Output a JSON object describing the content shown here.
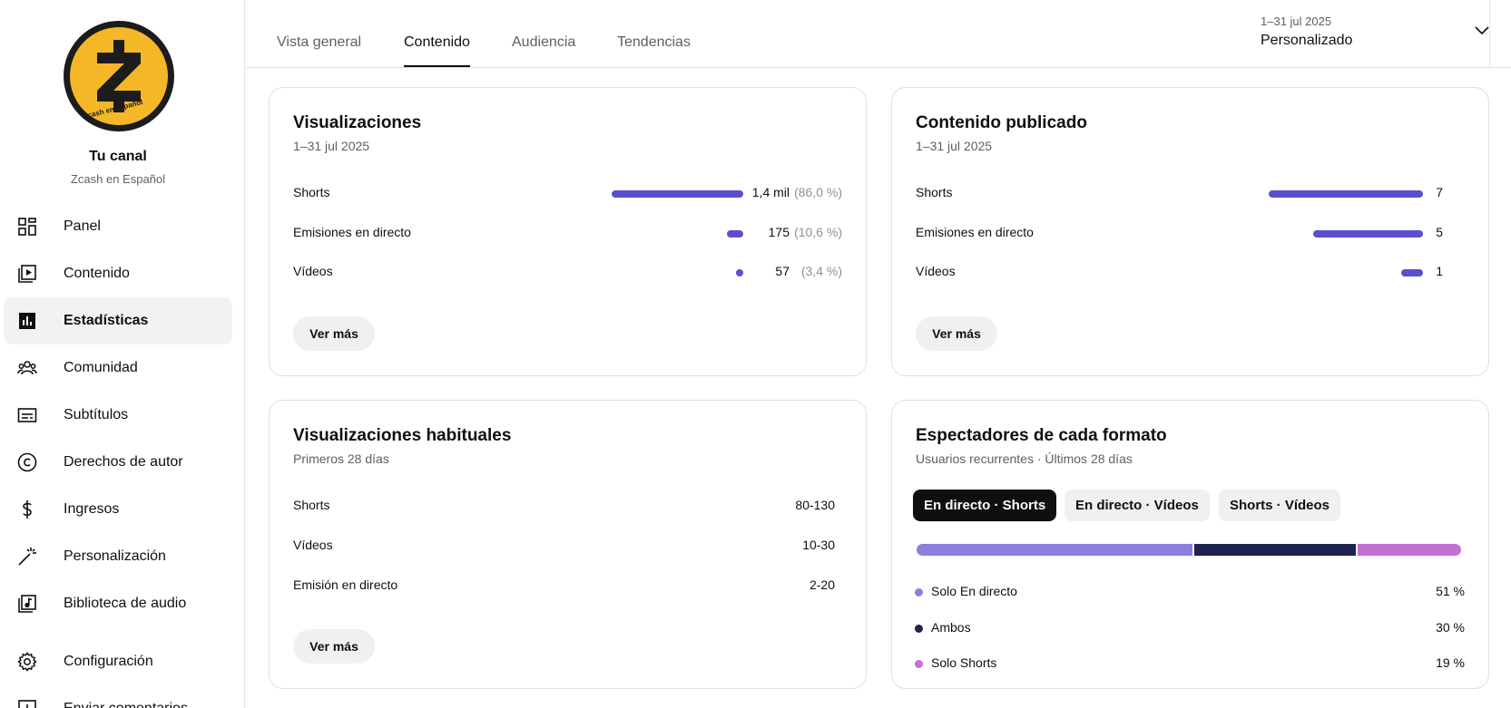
{
  "sidebar": {
    "channel_title": "Tu canal",
    "channel_name": "Zcash en Español",
    "avatar_text": "Zcash en español",
    "items": [
      {
        "label": "Panel",
        "icon": "dashboard-icon"
      },
      {
        "label": "Contenido",
        "icon": "content-icon"
      },
      {
        "label": "Estadísticas",
        "icon": "analytics-icon",
        "active": true
      },
      {
        "label": "Comunidad",
        "icon": "community-icon"
      },
      {
        "label": "Subtítulos",
        "icon": "subtitles-icon"
      },
      {
        "label": "Derechos de autor",
        "icon": "copyright-icon"
      },
      {
        "label": "Ingresos",
        "icon": "dollar-icon"
      },
      {
        "label": "Personalización",
        "icon": "magic-wand-icon"
      },
      {
        "label": "Biblioteca de audio",
        "icon": "audio-library-icon"
      },
      {
        "label": "Configuración",
        "icon": "gear-icon"
      },
      {
        "label": "Enviar comentarios",
        "icon": "feedback-icon"
      }
    ]
  },
  "tabs": [
    {
      "label": "Vista general"
    },
    {
      "label": "Contenido",
      "active": true
    },
    {
      "label": "Audiencia"
    },
    {
      "label": "Tendencias"
    }
  ],
  "date_range": {
    "range": "1–31 jul 2025",
    "label": "Personalizado"
  },
  "views_card": {
    "title": "Visualizaciones",
    "subtitle": "1–31 jul 2025",
    "rows": [
      {
        "label": "Shorts",
        "value": "1,4 mil",
        "pct": "(86,0 %)",
        "fraction": 0.86
      },
      {
        "label": "Emisiones en directo",
        "value": "175",
        "pct": "(10,6 %)",
        "fraction": 0.106
      },
      {
        "label": "Vídeos",
        "value": "57",
        "pct": "(3,4 %)",
        "fraction": 0.034
      }
    ],
    "button": "Ver más"
  },
  "published_card": {
    "title": "Contenido publicado",
    "subtitle": "1–31 jul 2025",
    "rows": [
      {
        "label": "Shorts",
        "value": "7",
        "count": 7
      },
      {
        "label": "Emisiones en directo",
        "value": "5",
        "count": 5
      },
      {
        "label": "Vídeos",
        "value": "1",
        "count": 1
      }
    ],
    "button": "Ver más"
  },
  "regular_views_card": {
    "title": "Visualizaciones habituales",
    "subtitle": "Primeros 28 días",
    "rows": [
      {
        "label": "Shorts",
        "value": "80-130"
      },
      {
        "label": "Vídeos",
        "value": "10-30"
      },
      {
        "label": "Emisión en directo",
        "value": "2-20"
      }
    ],
    "button": "Ver más"
  },
  "format_viewers_card": {
    "title": "Espectadores de cada formato",
    "subtitle": "Usuarios recurrentes · Últimos 28 días",
    "chips": [
      {
        "label": "En directo · Shorts",
        "selected": true
      },
      {
        "label": "En directo · Vídeos",
        "selected": false
      },
      {
        "label": "Shorts · Vídeos",
        "selected": false
      }
    ],
    "segments": [
      {
        "label": "Solo En directo",
        "value": "51 %",
        "share": 51,
        "color": "#8b80e0"
      },
      {
        "label": "Ambos",
        "value": "30 %",
        "share": 30,
        "color": "#1f2150"
      },
      {
        "label": "Solo Shorts",
        "value": "19 %",
        "share": 19,
        "color": "#c46fd6"
      }
    ]
  },
  "colors": {
    "accent_bar": "#5a4fcf",
    "active_tab": "#0f0f0f",
    "avatar_yellow": "#f4b728"
  }
}
